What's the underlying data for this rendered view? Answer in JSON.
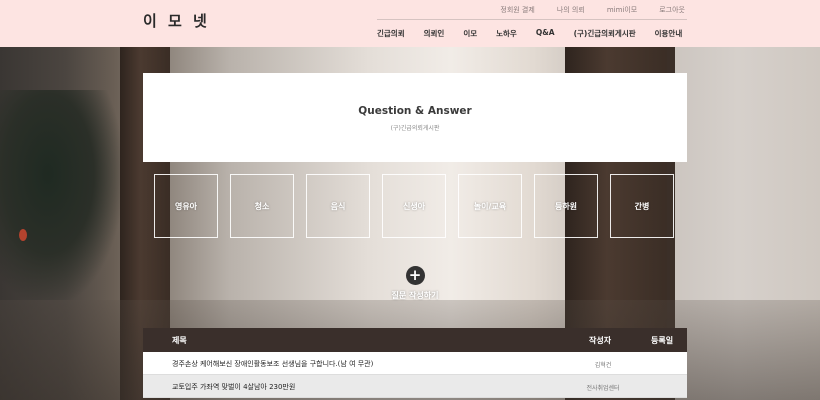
{
  "header": {
    "logo": "이 모 넷",
    "util_links": [
      "정회원 결제",
      "나의 의뢰",
      "mimi이모",
      "로그아웃"
    ],
    "gnb": [
      "긴급의뢰",
      "의뢰인",
      "이모",
      "노하우",
      "Q&A",
      "(구)긴급의뢰게시판",
      "이용안내"
    ]
  },
  "qa": {
    "title": "Question & Answer",
    "subtitle": "(구)긴급의뢰게시판"
  },
  "categories": [
    "영유아",
    "청소",
    "음식",
    "신생아",
    "놀이/교육",
    "등하원",
    "간병"
  ],
  "write": {
    "icon": "plus-icon",
    "label": "질문 작성하기"
  },
  "board": {
    "headers": {
      "title": "제목",
      "writer": "작성자",
      "date": "등록일"
    },
    "rows": [
      {
        "title": "경주손상 케어해보신 장애인활동보조 선생님을 구합니다.(남 여 무관)",
        "writer": "김혁건"
      },
      {
        "title": "교토입주 가좌역 맞벌이 4살남아 230만원",
        "writer": "전사취업센터"
      }
    ]
  },
  "colors": {
    "header_bg": "#fde4e2",
    "table_header_bg": "#3a2f2b"
  }
}
